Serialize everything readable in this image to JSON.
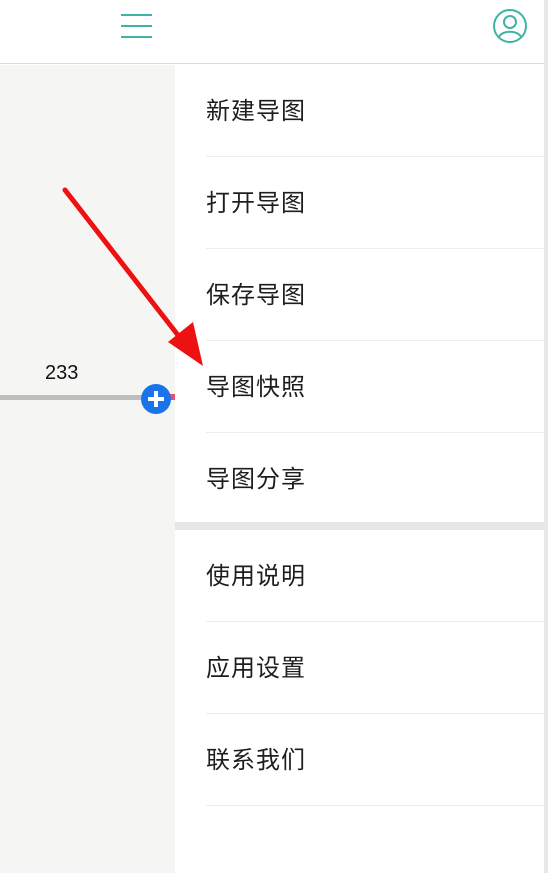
{
  "header": {
    "menu_icon": "hamburger-menu-icon",
    "user_icon": "user-account-icon",
    "accent_color": "#3fb3a6"
  },
  "canvas": {
    "node_text": "233",
    "add_icon": "plus-circle-icon",
    "add_color": "#1a73e8"
  },
  "menu": {
    "group1": [
      "新建导图",
      "打开导图",
      "保存导图",
      "导图快照",
      "导图分享"
    ],
    "group2": [
      "使用说明",
      "应用设置",
      "联系我们"
    ]
  },
  "annotation": {
    "arrow_color": "#ee1111"
  }
}
